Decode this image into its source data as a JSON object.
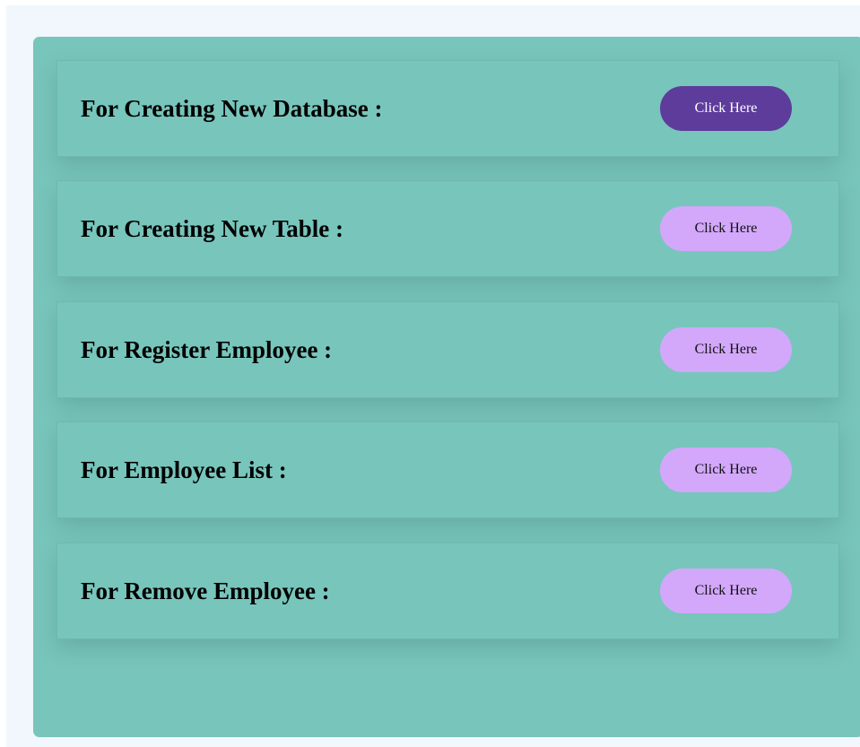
{
  "actions": [
    {
      "label": "For Creating New Database :",
      "button": "Click Here",
      "active": true
    },
    {
      "label": "For Creating New Table :",
      "button": "Click Here",
      "active": false
    },
    {
      "label": "For Register Employee :",
      "button": "Click Here",
      "active": false
    },
    {
      "label": "For Employee List :",
      "button": "Click Here",
      "active": false
    },
    {
      "label": "For Remove Employee :",
      "button": "Click Here",
      "active": false
    }
  ],
  "colors": {
    "page_background": "#f1f7fd",
    "panel_background": "#78c5bc",
    "button_default": "#d3a8fb",
    "button_active": "#5e3c9b"
  }
}
